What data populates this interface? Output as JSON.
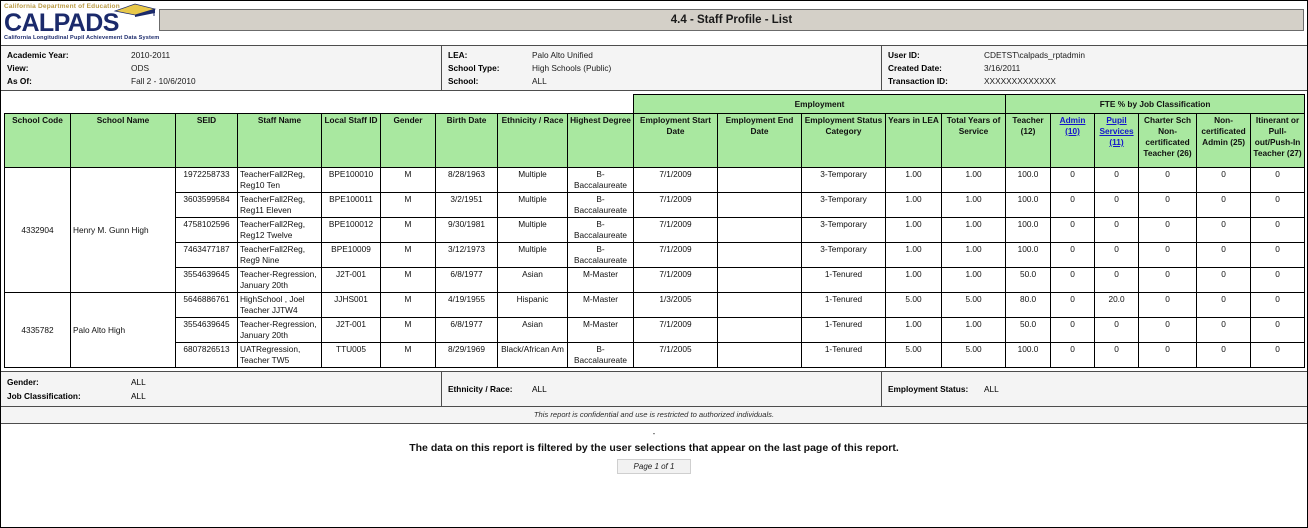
{
  "logo": {
    "top_line": "California Department of Education",
    "main": "CALPADS",
    "sub_line": "California Longitudinal Pupil Achievement Data System"
  },
  "header": {
    "title": "4.4 - Staff Profile - List"
  },
  "params": {
    "left": [
      {
        "label": "Academic Year:",
        "value": "2010-2011"
      },
      {
        "label": "View:",
        "value": "ODS"
      },
      {
        "label": "As Of:",
        "value": "Fall 2 - 10/6/2010"
      }
    ],
    "middle": [
      {
        "label": "LEA:",
        "value": "Palo Alto Unified"
      },
      {
        "label": "School Type:",
        "value": "High Schools (Public)"
      },
      {
        "label": "School:",
        "value": "ALL"
      }
    ],
    "right": [
      {
        "label": "User ID:",
        "value": "CDETST\\calpads_rptadmin"
      },
      {
        "label": "Created Date:",
        "value": "3/16/2011"
      },
      {
        "label": "Transaction ID:",
        "value": "XXXXXXXXXXXXX"
      }
    ]
  },
  "table": {
    "group_headers": {
      "employment": "Employment",
      "fte": "FTE % by Job Classification"
    },
    "columns": [
      "School Code",
      "School Name",
      "SEID",
      "Staff Name",
      "Local Staff ID",
      "Gender",
      "Birth Date",
      "Ethnicity / Race",
      "Highest Degree",
      "Employment Start Date",
      "Employment End Date",
      "Employment Status Category",
      "Years in LEA",
      "Total Years of Service",
      "Teacher (12)",
      "Admin (10)",
      "Pupil Services (11)",
      "Charter Sch Non-certificated Teacher (26)",
      "Non-certificated Admin (25)",
      "Itinerant or Pull-out/Push-In Teacher (27)"
    ],
    "fte_links": [
      {
        "label": "Admin",
        "code": "(10)"
      },
      {
        "label": "Pupil Services",
        "code": "(11)"
      }
    ],
    "schools": [
      {
        "code": "4332904",
        "name": "Henry M. Gunn High",
        "rows": 5
      },
      {
        "code": "4335782",
        "name": "Palo Alto High",
        "rows": 3
      }
    ],
    "rows": [
      {
        "seid": "1972258733",
        "staff_name": "TeacherFall2Reg, Reg10 Ten",
        "local_staff_id": "BPE100010",
        "gender": "M",
        "birth_date": "8/28/1963",
        "ethnicity": "Multiple",
        "degree": "B-Baccalaureate",
        "emp_start": "7/1/2009",
        "emp_end": "",
        "emp_status": "3-Temporary",
        "years_lea": "1.00",
        "total_years": "1.00",
        "teacher": "100.0",
        "admin": "0",
        "pupil_services": "0",
        "charter_noncert_teacher": "0",
        "noncert_admin": "0",
        "itinerant": "0"
      },
      {
        "seid": "3603599584",
        "staff_name": "TeacherFall2Reg, Reg11 Eleven",
        "local_staff_id": "BPE100011",
        "gender": "M",
        "birth_date": "3/2/1951",
        "ethnicity": "Multiple",
        "degree": "B-Baccalaureate",
        "emp_start": "7/1/2009",
        "emp_end": "",
        "emp_status": "3-Temporary",
        "years_lea": "1.00",
        "total_years": "1.00",
        "teacher": "100.0",
        "admin": "0",
        "pupil_services": "0",
        "charter_noncert_teacher": "0",
        "noncert_admin": "0",
        "itinerant": "0"
      },
      {
        "seid": "4758102596",
        "staff_name": "TeacherFall2Reg, Reg12 Twelve",
        "local_staff_id": "BPE100012",
        "gender": "M",
        "birth_date": "9/30/1981",
        "ethnicity": "Multiple",
        "degree": "B-Baccalaureate",
        "emp_start": "7/1/2009",
        "emp_end": "",
        "emp_status": "3-Temporary",
        "years_lea": "1.00",
        "total_years": "1.00",
        "teacher": "100.0",
        "admin": "0",
        "pupil_services": "0",
        "charter_noncert_teacher": "0",
        "noncert_admin": "0",
        "itinerant": "0"
      },
      {
        "seid": "7463477187",
        "staff_name": "TeacherFall2Reg, Reg9 Nine",
        "local_staff_id": "BPE10009",
        "gender": "M",
        "birth_date": "3/12/1973",
        "ethnicity": "Multiple",
        "degree": "B-Baccalaureate",
        "emp_start": "7/1/2009",
        "emp_end": "",
        "emp_status": "3-Temporary",
        "years_lea": "1.00",
        "total_years": "1.00",
        "teacher": "100.0",
        "admin": "0",
        "pupil_services": "0",
        "charter_noncert_teacher": "0",
        "noncert_admin": "0",
        "itinerant": "0"
      },
      {
        "seid": "3554639645",
        "staff_name": "Teacher-Regression, January 20th",
        "local_staff_id": "J2T-001",
        "gender": "M",
        "birth_date": "6/8/1977",
        "ethnicity": "Asian",
        "degree": "M-Master",
        "emp_start": "7/1/2009",
        "emp_end": "",
        "emp_status": "1-Tenured",
        "years_lea": "1.00",
        "total_years": "1.00",
        "teacher": "50.0",
        "admin": "0",
        "pupil_services": "0",
        "charter_noncert_teacher": "0",
        "noncert_admin": "0",
        "itinerant": "0"
      },
      {
        "seid": "5646886761",
        "staff_name": "HighSchool , Joel Teacher JJTW4",
        "local_staff_id": "JJHS001",
        "gender": "M",
        "birth_date": "4/19/1955",
        "ethnicity": "Hispanic",
        "degree": "M-Master",
        "emp_start": "1/3/2005",
        "emp_end": "",
        "emp_status": "1-Tenured",
        "years_lea": "5.00",
        "total_years": "5.00",
        "teacher": "80.0",
        "admin": "0",
        "pupil_services": "20.0",
        "charter_noncert_teacher": "0",
        "noncert_admin": "0",
        "itinerant": "0"
      },
      {
        "seid": "3554639645",
        "staff_name": "Teacher-Regression, January 20th",
        "local_staff_id": "J2T-001",
        "gender": "M",
        "birth_date": "6/8/1977",
        "ethnicity": "Asian",
        "degree": "M-Master",
        "emp_start": "7/1/2009",
        "emp_end": "",
        "emp_status": "1-Tenured",
        "years_lea": "1.00",
        "total_years": "1.00",
        "teacher": "50.0",
        "admin": "0",
        "pupil_services": "0",
        "charter_noncert_teacher": "0",
        "noncert_admin": "0",
        "itinerant": "0"
      },
      {
        "seid": "6807826513",
        "staff_name": "UATRegression, Teacher TW5",
        "local_staff_id": "TTU005",
        "gender": "M",
        "birth_date": "8/29/1969",
        "ethnicity": "Black/African Am",
        "degree": "B-Baccalaureate",
        "emp_start": "7/1/2005",
        "emp_end": "",
        "emp_status": "1-Tenured",
        "years_lea": "5.00",
        "total_years": "5.00",
        "teacher": "100.0",
        "admin": "0",
        "pupil_services": "0",
        "charter_noncert_teacher": "0",
        "noncert_admin": "0",
        "itinerant": "0"
      }
    ]
  },
  "filters": {
    "left": [
      {
        "label": "Gender:",
        "value": "ALL"
      },
      {
        "label": "Job Classification:",
        "value": "ALL"
      }
    ],
    "middle": [
      {
        "label": "Ethnicity / Race:",
        "value": "ALL"
      }
    ],
    "right": [
      {
        "label": "Employment Status:",
        "value": "ALL"
      }
    ]
  },
  "footer": {
    "confidential": "This report is confidential and use is restricted to authorized individuals.",
    "dash": "-",
    "filter_note": "The data on this report is filtered by the user selections that appear on the last page of this report.",
    "page": "Page 1 of 1"
  },
  "colors": {
    "header_green": "#a9e8a0",
    "logo_navy": "#1b2a6b",
    "logo_gold": "#b99a44",
    "link_blue": "#1414cc",
    "titlebar_gray": "#d4d0c8"
  }
}
